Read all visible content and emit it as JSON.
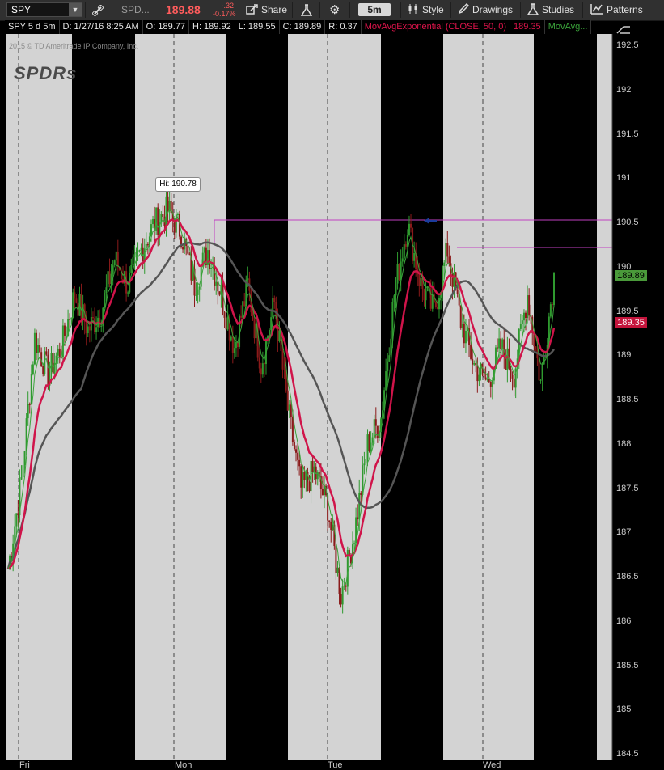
{
  "toolbar": {
    "symbol": "SPY",
    "description": "SPD...",
    "last_price": "189.88",
    "change": "-.32",
    "change_pct": "-0.17%",
    "share_label": "Share",
    "timeframe": "5m",
    "style_label": "Style",
    "drawings_label": "Drawings",
    "studies_label": "Studies",
    "patterns_label": "Patterns"
  },
  "infobar": {
    "period": "SPY 5 d 5m",
    "datetime": "D: 1/27/16 8:25 AM",
    "open": "O: 189.77",
    "high": "H: 189.92",
    "low": "L: 189.55",
    "close": "C: 189.89",
    "range": "R: 0.37",
    "study1": "MovAvgExponential (CLOSE, 50, 0)",
    "study1_value": "189.35",
    "study2": "MovAvg..."
  },
  "watermark": {
    "copyright": "2015 © TD Ameritrade IP Company, Inc.",
    "logo": "SPDRs"
  },
  "annotation": {
    "hi_label": "Hi: 190.78"
  },
  "axis": {
    "labels": [
      "192.5",
      "192",
      "191.5",
      "191",
      "190.5",
      "190",
      "189.5",
      "189",
      "188.5",
      "188",
      "187.5",
      "187",
      "186.5",
      "186",
      "185.5",
      "185",
      "184.5"
    ],
    "last_close_tag": "189.89",
    "ema_tag": "189.35"
  },
  "days": [
    "Fri",
    "Mon",
    "Tue",
    "Wed"
  ],
  "colors": {
    "up": "#2f9a2f",
    "down": "#8b1a1a",
    "ema": "#d0144a",
    "fast_ma": "#3aa33a",
    "slow_ma": "#555555",
    "shade": "#d3d3d3",
    "hline": "#c040c0"
  },
  "chart_data": {
    "type": "candlestick",
    "timeframe": "5m",
    "ylim": [
      184.5,
      192.5
    ],
    "session_high": 190.78,
    "last": 189.89,
    "series": [
      {
        "name": "MovAvgExponential (CLOSE, 50, 0)",
        "value": 189.35
      },
      {
        "name": "MovAvg...",
        "value": 189.89
      }
    ],
    "price_path": [
      186.6,
      187.6,
      189.2,
      188.8,
      189.1,
      189.7,
      189.3,
      189.5,
      190.1,
      189.8,
      190.2,
      190.5,
      190.65,
      190.4,
      189.8,
      190.2,
      189.7,
      189.1,
      189.8,
      188.9,
      189.6,
      188.4,
      187.5,
      187.7,
      187.3,
      186.3,
      187.0,
      188.0,
      188.3,
      189.7,
      190.5,
      189.8,
      189.5,
      190.2,
      189.4,
      188.9,
      188.7,
      189.1,
      188.8,
      189.7,
      188.7,
      189.9
    ]
  }
}
